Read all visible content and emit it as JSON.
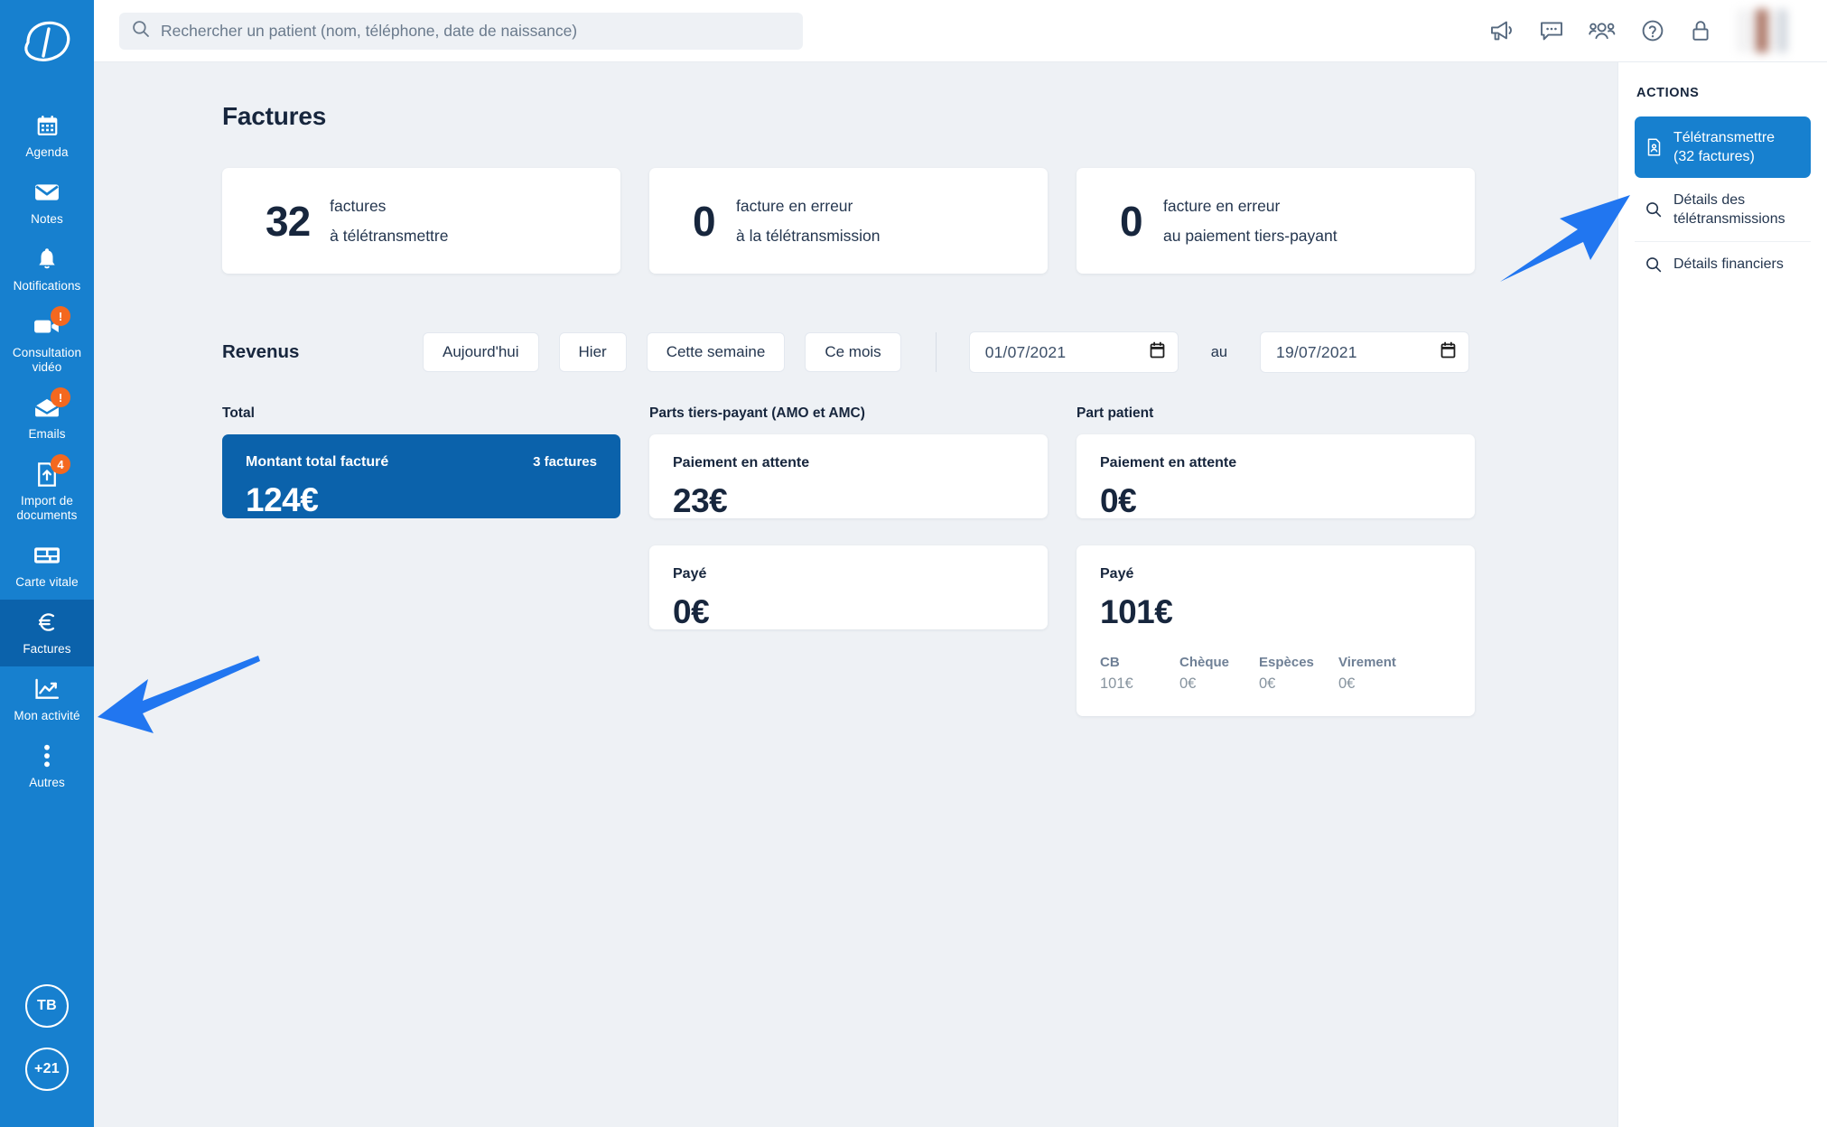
{
  "brand": {
    "logo_letter": "D",
    "sidebar_color": "#1780cf",
    "active_color": "#0b62ab",
    "accent_color": "#2176f0",
    "badge_color": "#f4681f"
  },
  "search": {
    "placeholder": "Rechercher un patient (nom, téléphone, date de naissance)",
    "value": ""
  },
  "topbar": {
    "icons": [
      {
        "name": "megaphone-icon",
        "label": "Annonces"
      },
      {
        "name": "chat-icon",
        "label": "Messagerie"
      },
      {
        "name": "users-icon",
        "label": "Équipe"
      },
      {
        "name": "help-icon",
        "label": "Aide"
      },
      {
        "name": "lock-icon",
        "label": "Verrouiller"
      }
    ]
  },
  "sidebar": {
    "items": [
      {
        "label": "Agenda",
        "icon": "calendar-icon",
        "badge": "",
        "active": false
      },
      {
        "label": "Notes",
        "icon": "envelope-icon",
        "badge": "",
        "active": false
      },
      {
        "label": "Notifications",
        "icon": "bell-icon",
        "badge": "",
        "active": false
      },
      {
        "label": "Consultation vidéo",
        "icon": "video-camera-icon",
        "badge": "!",
        "active": false
      },
      {
        "label": "Emails",
        "icon": "email-open-icon",
        "badge": "!",
        "active": false
      },
      {
        "label": "Import de documents",
        "icon": "document-upload-icon",
        "badge": "4",
        "active": false
      },
      {
        "label": "Carte vitale",
        "icon": "id-card-icon",
        "badge": "",
        "active": false
      },
      {
        "label": "Factures",
        "icon": "euro-icon",
        "badge": "",
        "active": true
      },
      {
        "label": "Mon activité",
        "icon": "chart-line-icon",
        "badge": "",
        "active": false
      },
      {
        "label": "Autres",
        "icon": "dots-vertical-icon",
        "badge": "",
        "active": false
      }
    ],
    "avatars": [
      {
        "label": "TB"
      },
      {
        "label": "+21"
      }
    ]
  },
  "page": {
    "title": "Factures"
  },
  "stats": [
    {
      "number": "32",
      "line1": "factures",
      "line2": "à télétransmettre"
    },
    {
      "number": "0",
      "line1": "facture en erreur",
      "line2": "à la télétransmission"
    },
    {
      "number": "0",
      "line1": "facture en erreur",
      "line2": "au paiement tiers-payant"
    }
  ],
  "revenus": {
    "title": "Revenus",
    "period_buttons": [
      "Aujourd'hui",
      "Hier",
      "Cette semaine",
      "Ce mois"
    ],
    "date_from": "01/07/2021",
    "date_to": "19/07/2021",
    "between_label": "au"
  },
  "columns": [
    {
      "label": "Total",
      "cards": [
        {
          "title": "Montant total facturé",
          "sub": "3 factures",
          "value": "124€",
          "primary": true
        }
      ]
    },
    {
      "label": "Parts tiers-payant (AMO et AMC)",
      "cards": [
        {
          "title": "Paiement en attente",
          "sub": "",
          "value": "23€",
          "primary": false
        },
        {
          "title": "Payé",
          "sub": "",
          "value": "0€",
          "primary": false
        }
      ]
    },
    {
      "label": "Part patient",
      "cards": [
        {
          "title": "Paiement en attente",
          "sub": "",
          "value": "0€",
          "primary": false
        },
        {
          "title": "Payé",
          "sub": "",
          "value": "101€",
          "primary": false
        }
      ]
    }
  ],
  "payment_breakdown": [
    {
      "key": "CB",
      "value": "101€"
    },
    {
      "key": "Chèque",
      "value": "0€"
    },
    {
      "key": "Espèces",
      "value": "0€"
    },
    {
      "key": "Virement",
      "value": "0€"
    }
  ],
  "actions": {
    "title": "ACTIONS",
    "primary": {
      "line1": "Télétransmettre",
      "line2": "(32 factures)",
      "icon": "document-icon"
    },
    "items": [
      {
        "line1": "Détails des",
        "line2": "télétransmissions",
        "icon": "search-icon"
      },
      {
        "line1": "Détails financiers",
        "line2": "",
        "icon": "search-icon"
      }
    ]
  }
}
